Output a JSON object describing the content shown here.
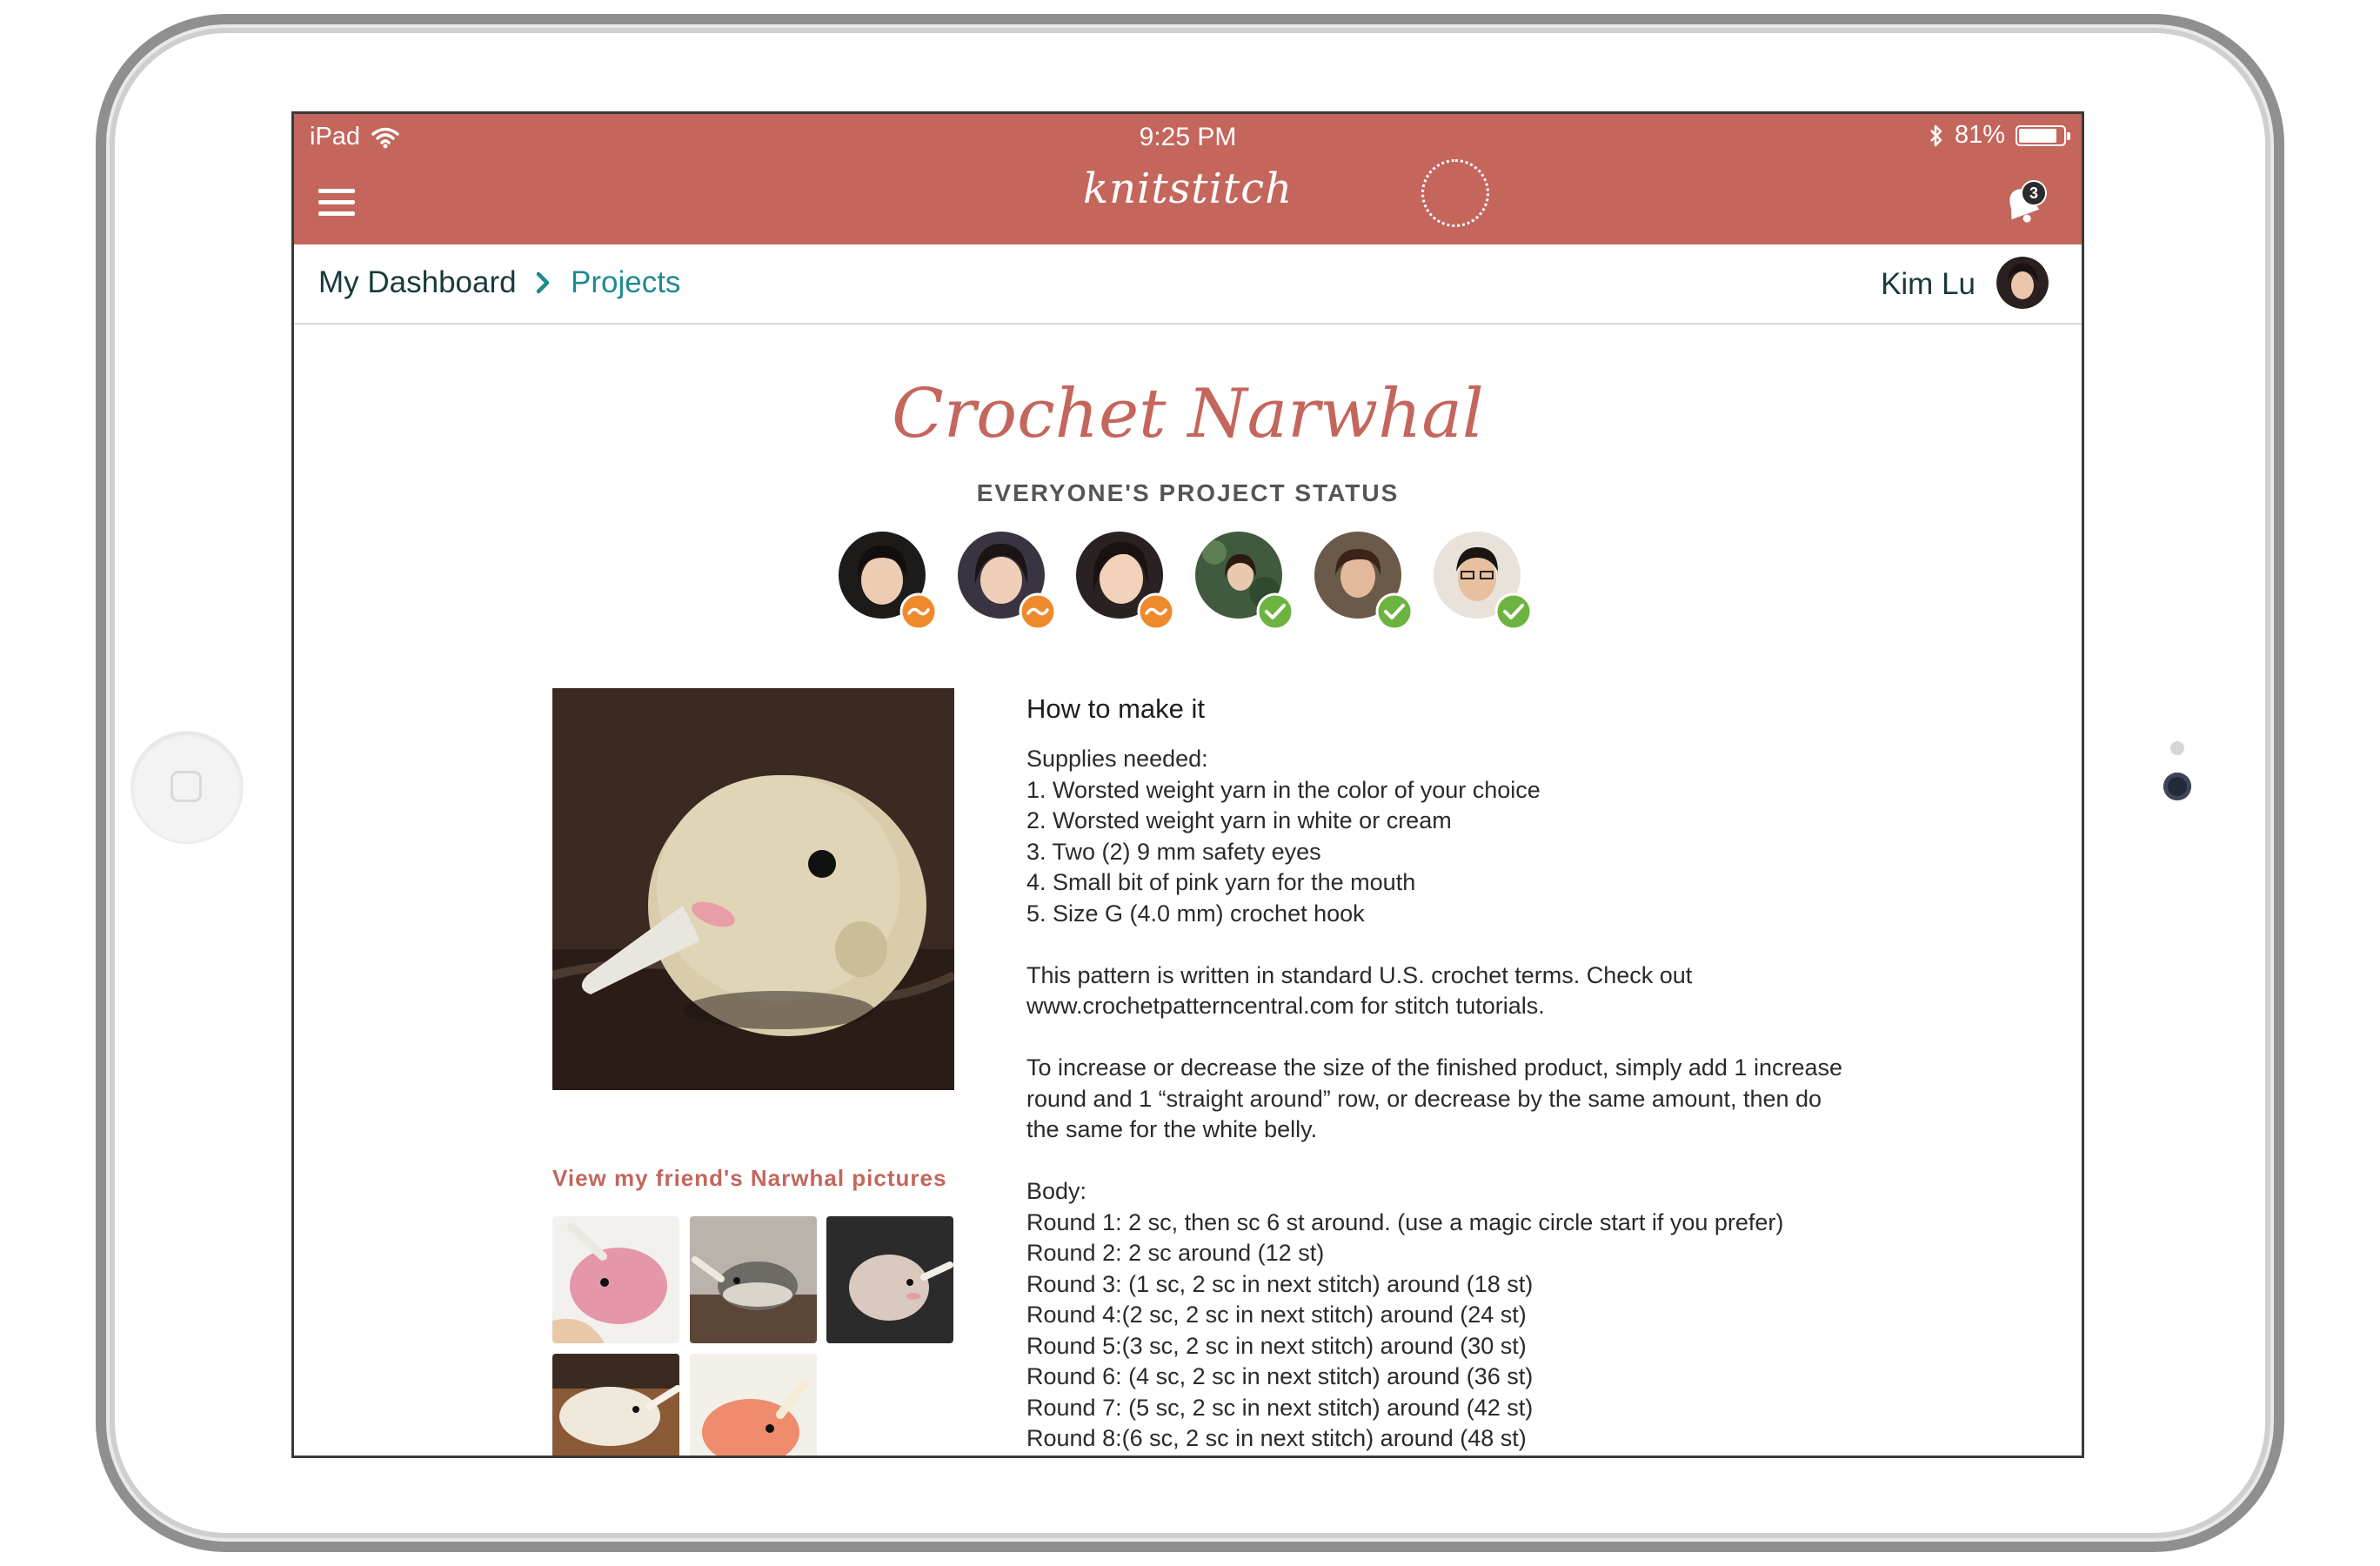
{
  "status_bar": {
    "device": "iPad",
    "time": "9:25 PM",
    "battery": "81%",
    "battery_level": 0.81
  },
  "app": {
    "logo": "knitstitch",
    "notification_count": "3",
    "accent_color": "#c4665c",
    "link_color": "#1f8a8f"
  },
  "breadcrumb": {
    "home": "My Dashboard",
    "current": "Projects"
  },
  "user": {
    "name": "Kim Lu"
  },
  "project": {
    "title": "Crochet Narwhal",
    "status_heading": "EVERYONE'S PROJECT STATUS",
    "participants": [
      {
        "status": "in-progress"
      },
      {
        "status": "in-progress"
      },
      {
        "status": "in-progress"
      },
      {
        "status": "complete"
      },
      {
        "status": "complete"
      },
      {
        "status": "complete"
      }
    ],
    "friends_label": "View my friend's Narwhal pictures",
    "instructions_title": "How to make it",
    "supplies_heading": "Supplies needed:",
    "supplies": [
      "1. Worsted weight yarn in the color of your choice",
      "2. Worsted weight yarn in white or cream",
      "3. Two (2) 9 mm safety eyes",
      "4. Small bit of pink yarn for the mouth",
      "5. Size G (4.0 mm) crochet hook"
    ],
    "terms_note": [
      "This pattern is written in standard U.S. crochet terms. Check out",
      "www.crochetpatterncentral.com for stitch tutorials."
    ],
    "size_note": [
      "To increase or decrease the size of the finished product, simply add 1 increase",
      "round and 1 “straight around” row, or decrease by the same amount, then do",
      "the same for the white belly."
    ],
    "body_heading": "Body:",
    "rounds": [
      "Round 1: 2 sc, then sc 6 st around. (use a magic circle start if you prefer)",
      "Round 2: 2 sc around (12 st)",
      "Round 3: (1 sc, 2 sc in next stitch) around (18 st)",
      "Round 4:(2 sc, 2 sc in next stitch) around (24 st)",
      "Round 5:(3 sc, 2 sc in next stitch) around (30 st)",
      "Round 6: (4 sc, 2 sc in next stitch) around (36 st)",
      "Round 7: (5 sc, 2 sc in next stitch) around (42 st)",
      "Round 8:(6 sc, 2 sc in next stitch) around (48 st)"
    ]
  }
}
